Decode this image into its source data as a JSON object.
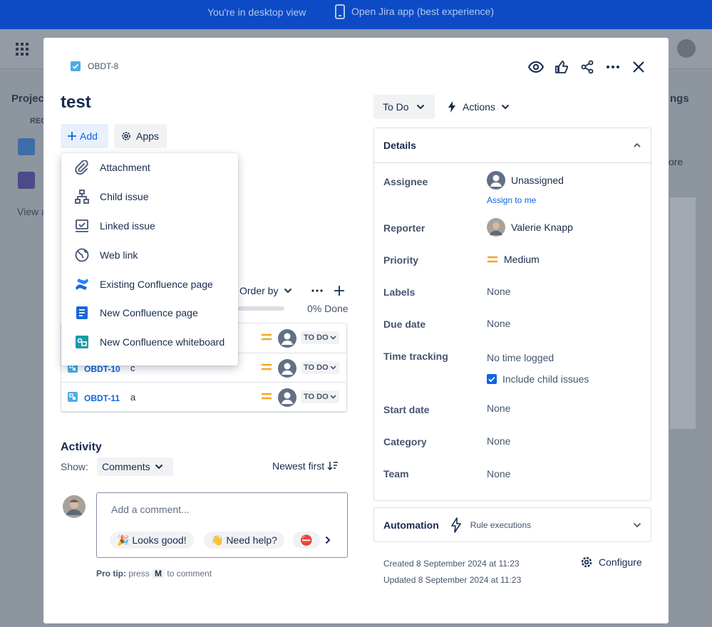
{
  "banner": {
    "desktop_text": "You're in desktop view",
    "app_link": "Open Jira app (best experience)"
  },
  "background": {
    "project_label": "Projec",
    "rec_label": "REC",
    "view_label": "View a",
    "ngs_label": "ngs",
    "more_label": "ore"
  },
  "issue": {
    "key": "OBDT-8",
    "title": "test"
  },
  "toolbar": {
    "add_label": "Add",
    "apps_label": "Apps"
  },
  "add_menu": {
    "items": [
      {
        "label": "Attachment",
        "icon": "paperclip-icon"
      },
      {
        "label": "Child issue",
        "icon": "hierarchy-icon"
      },
      {
        "label": "Linked issue",
        "icon": "linked-issue-icon"
      },
      {
        "label": "Web link",
        "icon": "globe-icon"
      },
      {
        "label": "Existing Confluence page",
        "icon": "confluence-icon"
      },
      {
        "label": "New Confluence page",
        "icon": "page-icon"
      },
      {
        "label": "New Confluence whiteboard",
        "icon": "whiteboard-icon"
      }
    ]
  },
  "child_issues": {
    "order_by": "Order by",
    "progress_percent": 0,
    "progress_label": "0% Done",
    "rows": [
      {
        "key": "",
        "summary": "",
        "status": "TO DO"
      },
      {
        "key": "OBDT-10",
        "summary": "c",
        "status": "TO DO"
      },
      {
        "key": "OBDT-11",
        "summary": "a",
        "status": "TO DO"
      }
    ]
  },
  "activity": {
    "heading": "Activity",
    "show_label": "Show:",
    "filter": "Comments",
    "sort": "Newest first",
    "placeholder": "Add a comment...",
    "chips": [
      "🎉 Looks good!",
      "👋 Need help?",
      "⛔"
    ],
    "protip_bold": "Pro tip:",
    "protip_pre": "press",
    "protip_key": "M",
    "protip_post": "to comment"
  },
  "status": {
    "value": "To Do",
    "actions": "Actions"
  },
  "details": {
    "heading": "Details",
    "assignee_label": "Assignee",
    "assignee_value": "Unassigned",
    "assign_to_me": "Assign to me",
    "reporter_label": "Reporter",
    "reporter_value": "Valerie Knapp",
    "priority_label": "Priority",
    "priority_value": "Medium",
    "labels_label": "Labels",
    "labels_value": "None",
    "due_label": "Due date",
    "due_value": "None",
    "time_label": "Time tracking",
    "time_value": "No time logged",
    "include_child": "Include child issues",
    "start_label": "Start date",
    "start_value": "None",
    "category_label": "Category",
    "category_value": "None",
    "team_label": "Team",
    "team_value": "None"
  },
  "automation": {
    "label": "Automation",
    "rule": "Rule executions"
  },
  "meta": {
    "created": "Created 8 September 2024 at 11:23",
    "updated": "Updated 8 September 2024 at 11:23",
    "configure": "Configure"
  },
  "colors": {
    "accent": "#0c66e4",
    "banner": "#0c4bc5",
    "priority_medium": "#f5a524",
    "checkbox": "#4bade8"
  }
}
